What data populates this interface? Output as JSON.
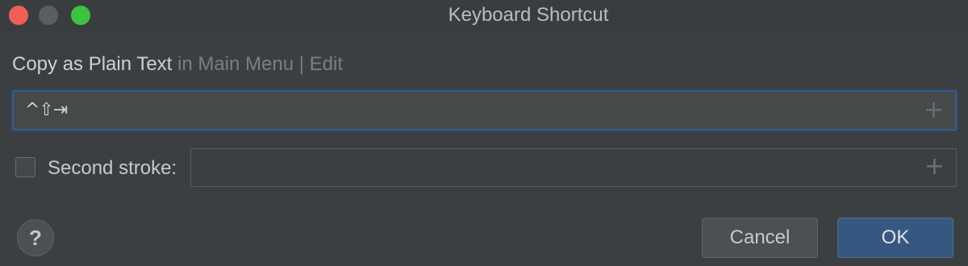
{
  "window": {
    "title": "Keyboard Shortcut",
    "controls": [
      "close",
      "minimize",
      "maximize"
    ]
  },
  "heading": {
    "action": "Copy as Plain Text",
    "path": " in Main Menu | Edit"
  },
  "shortcut": {
    "keys": "^⇧⇥",
    "add_icon": "plus-icon"
  },
  "second_stroke": {
    "label": "Second stroke:",
    "checked": false,
    "value": "",
    "add_icon": "plus-icon"
  },
  "buttons": {
    "help": "?",
    "cancel": "Cancel",
    "ok": "OK"
  },
  "colors": {
    "background": "#3c3f41",
    "focus_border": "#355b86",
    "ok_button": "#365880"
  }
}
